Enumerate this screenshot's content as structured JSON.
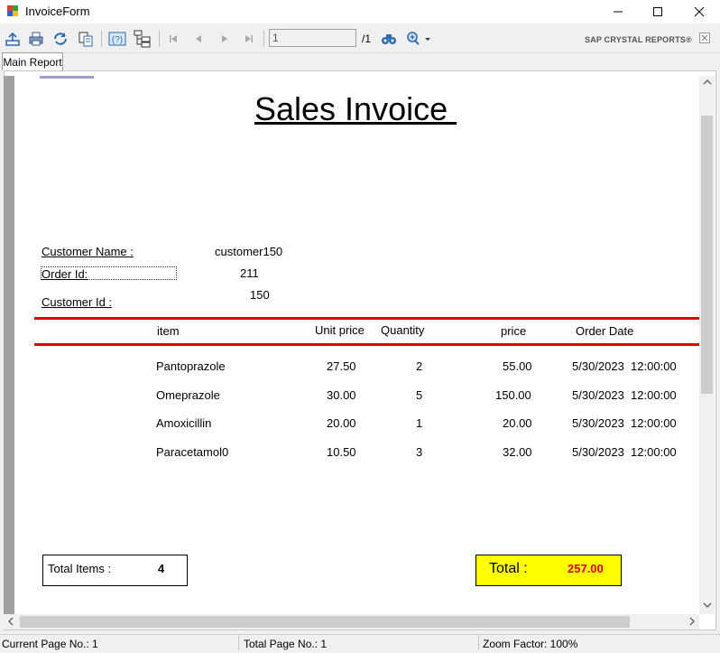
{
  "window": {
    "title": "InvoiceForm"
  },
  "toolbar": {
    "page_value": "1",
    "page_total": "/1",
    "brand": "SAP CRYSTAL REPORTS®"
  },
  "tabs": [
    {
      "label": "Main Report"
    }
  ],
  "report": {
    "title": "Sales Invoice ",
    "customer_name_label": "Customer Name :",
    "customer_name_value": "customer150",
    "order_id_label": "Order Id:",
    "order_id_value": "211",
    "customer_id_label": "Customer Id :",
    "customer_id_value": "150",
    "headers": {
      "item": "item",
      "unit_price": "Unit price",
      "quantity": "Quantity",
      "price": "price",
      "order_date": "Order Date"
    },
    "rows": [
      {
        "item": "Pantoprazole",
        "unit_price": "27.50",
        "quantity": "2",
        "price": "55.00",
        "order_date": "5/30/2023  12:00:00"
      },
      {
        "item": "Omeprazole",
        "unit_price": "30.00",
        "quantity": "5",
        "price": "150.00",
        "order_date": "5/30/2023  12:00:00"
      },
      {
        "item": "Amoxicillin",
        "unit_price": "20.00",
        "quantity": "1",
        "price": "20.00",
        "order_date": "5/30/2023  12:00:00"
      },
      {
        "item": "Paracetamol0",
        "unit_price": "10.50",
        "quantity": "3",
        "price": "32.00",
        "order_date": "5/30/2023  12:00:00"
      }
    ],
    "total_items_label": "Total Items :",
    "total_items_value": "4",
    "total_label": "Total :",
    "total_value": "257.00"
  },
  "statusbar": {
    "current_page": "Current Page No.: 1",
    "total_page": "Total Page No.: 1",
    "zoom": "Zoom Factor: 100%"
  },
  "colors": {
    "rule": "#e00000",
    "total_bg": "#ffff00",
    "total_value": "#e00000",
    "icon_blue": "#2b6cb0"
  },
  "icons": [
    "app-icon",
    "export-icon",
    "print-icon",
    "refresh-icon",
    "copy-icon",
    "help-icon",
    "group-tree-icon",
    "first-page-icon",
    "prev-page-icon",
    "next-page-icon",
    "last-page-icon",
    "find-icon",
    "zoom-icon",
    "close-icon"
  ]
}
